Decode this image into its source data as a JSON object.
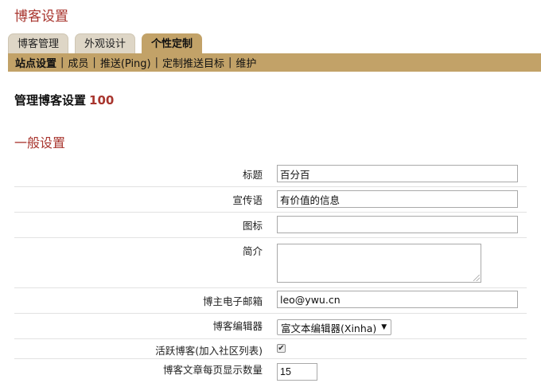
{
  "page": {
    "title": "博客设置"
  },
  "tabs": [
    {
      "label": "博客管理",
      "active": false
    },
    {
      "label": "外观设计",
      "active": false
    },
    {
      "label": "个性定制",
      "active": true
    }
  ],
  "subnav": {
    "items": [
      "站点设置",
      "成员",
      "推送(Ping)",
      "定制推送目标",
      "维护"
    ],
    "separator": "|"
  },
  "manage": {
    "label": "管理博客设置",
    "count": "100"
  },
  "section": {
    "title": "一般设置"
  },
  "form": {
    "title": {
      "label": "标题",
      "value": "百分百"
    },
    "tagline": {
      "label": "宣传语",
      "value": "有价值的信息"
    },
    "icon": {
      "label": "图标",
      "value": ""
    },
    "intro": {
      "label": "简介",
      "value": ""
    },
    "email": {
      "label": "博主电子邮箱",
      "value": "leo@ywu.cn"
    },
    "editor": {
      "label": "博客编辑器",
      "selected": "富文本编辑器(Xinha)"
    },
    "active": {
      "label": "活跃博客(加入社区列表)",
      "checked": true,
      "mark": "✔"
    },
    "per_page": {
      "label": "博客文章每页显示数量",
      "value": "15"
    }
  },
  "colors": {
    "accent": "#a8352e",
    "tab_bar": "#c2a268",
    "tab_inactive": "#ded6c6"
  }
}
